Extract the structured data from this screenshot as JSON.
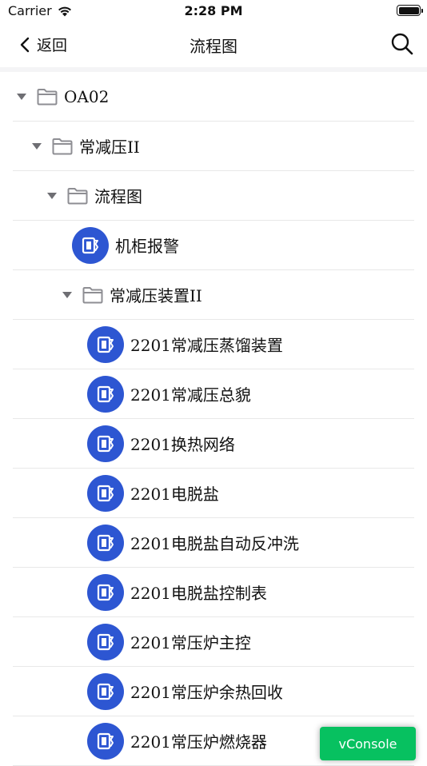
{
  "status_bar": {
    "carrier": "Carrier",
    "time": "2:28 PM"
  },
  "nav": {
    "back_label": "返回",
    "title": "流程图"
  },
  "tree": [
    {
      "label": "OA02",
      "type": "folder",
      "level": 0,
      "expanded": true
    },
    {
      "label": "常减压II",
      "type": "folder",
      "level": 1,
      "expanded": true
    },
    {
      "label": "流程图",
      "type": "folder",
      "level": 2,
      "expanded": true
    },
    {
      "label": "机柜报警",
      "type": "file",
      "level": 3
    },
    {
      "label": "常减压装置II",
      "type": "folder",
      "level": 3,
      "expanded": true
    },
    {
      "label": "2201常减压蒸馏装置",
      "type": "file",
      "level": 4
    },
    {
      "label": "2201常减压总貌",
      "type": "file",
      "level": 4
    },
    {
      "label": "2201换热网络",
      "type": "file",
      "level": 4
    },
    {
      "label": "2201电脱盐",
      "type": "file",
      "level": 4
    },
    {
      "label": "2201电脱盐自动反冲洗",
      "type": "file",
      "level": 4
    },
    {
      "label": "2201电脱盐控制表",
      "type": "file",
      "level": 4
    },
    {
      "label": "2201常压炉主控",
      "type": "file",
      "level": 4
    },
    {
      "label": "2201常压炉余热回收",
      "type": "file",
      "level": 4
    },
    {
      "label": "2201常压炉燃烧器",
      "type": "file",
      "level": 4
    }
  ],
  "vconsole_label": "vConsole",
  "colors": {
    "file_icon_bg": "#2d56d2",
    "folder": "#8e8e93",
    "vconsole": "#07c160"
  }
}
